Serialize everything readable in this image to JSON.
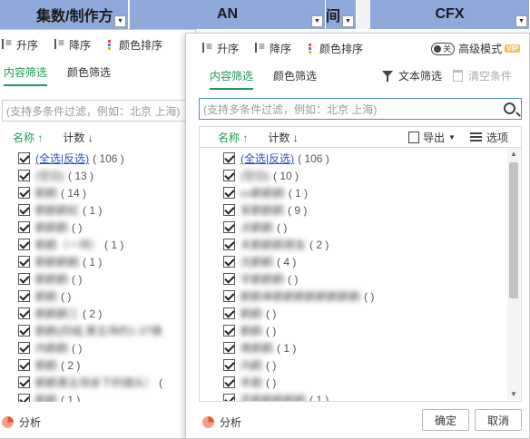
{
  "sheet": {
    "columns": [
      {
        "label": "集数/制作方"
      },
      {
        "label": "AN"
      },
      {
        "label": "间"
      },
      {
        "label": "CFX"
      }
    ]
  },
  "toolbar": {
    "asc": "升序",
    "desc": "降序",
    "color_sort": "颜色排序",
    "toggle_state": "关",
    "advanced": "高级模式",
    "vip": "VIP"
  },
  "tabs": {
    "content": "内容筛选",
    "color": "颜色筛选"
  },
  "tools": {
    "text_filter": "文本筛选",
    "clear": "清空条件",
    "export": "导出",
    "options": "选项"
  },
  "search": {
    "placeholder": "(支持多条件过滤，例如：北京  上海)"
  },
  "list_header": {
    "name": "名称",
    "count": "计数"
  },
  "back_list": {
    "select_all": "(全选|反选)",
    "select_all_count": "( 106 )",
    "items": [
      {
        "label": "(空白)",
        "count": "( 13 )"
      },
      {
        "label": "鹤鹤",
        "count": "( 14 )"
      },
      {
        "label": "鹤鹤鹤虹",
        "count": "( 1 )"
      },
      {
        "label": "鹤鹤鹤",
        "count": "( )"
      },
      {
        "label": "鹤鹤（一场）",
        "count": "( 1 )"
      },
      {
        "label": "鹤鹤鹤鹤",
        "count": "( 1 )"
      },
      {
        "label": "鹤鹤鹤",
        "count": "( )"
      },
      {
        "label": "鹤鹤",
        "count": "( )"
      },
      {
        "label": "鹤鹤鹤三",
        "count": "( 2 )"
      },
      {
        "label": "鹤鹤(四组,第五场的1-37镜",
        "count": ""
      },
      {
        "label": "内鹤鹤",
        "count": "( )"
      },
      {
        "label": "鹤鹤",
        "count": "( 2 )"
      },
      {
        "label": "鹤鹤第五场余下的镜头）",
        "count": "("
      },
      {
        "label": "鹤鹤",
        "count": "( 1 )"
      }
    ]
  },
  "front_list": {
    "select_all": "(全选|反选)",
    "select_all_count": "( 106 )",
    "items": [
      {
        "label": "(空白)",
        "count": "( 10 )"
      },
      {
        "label": "co鹤鹤鹤",
        "count": "( 1 )"
      },
      {
        "label": "安鹤鹤鹤",
        "count": "( 9 )"
      },
      {
        "label": "点鹤鹤",
        "count": "( )"
      },
      {
        "label": "夫鹤鹤鹤朋友",
        "count": "( 2 )"
      },
      {
        "label": "光鹤鹤",
        "count": "( 4 )"
      },
      {
        "label": "华鹤鹤鹤",
        "count": "( )"
      },
      {
        "label": "鹤鹤单鹤鹤鹤鹤鹤鹤鹤鹤",
        "count": "( )"
      },
      {
        "label": "鹤鹤",
        "count": "( )"
      },
      {
        "label": "鹤鹤",
        "count": "( )"
      },
      {
        "label": "南鹤鹤",
        "count": "( 1 )"
      },
      {
        "label": "内鹤",
        "count": "( )"
      },
      {
        "label": "年鹤",
        "count": "( )"
      },
      {
        "label": "苏鹤鹤鹤鹤鹤",
        "count": "( 1 )"
      }
    ]
  },
  "footer": {
    "analysis": "分析",
    "ok": "确定",
    "cancel": "取消"
  },
  "colors": {
    "accent": "#1f9a55",
    "header_blue": "#8eaadb",
    "link": "#2a4fbf"
  }
}
